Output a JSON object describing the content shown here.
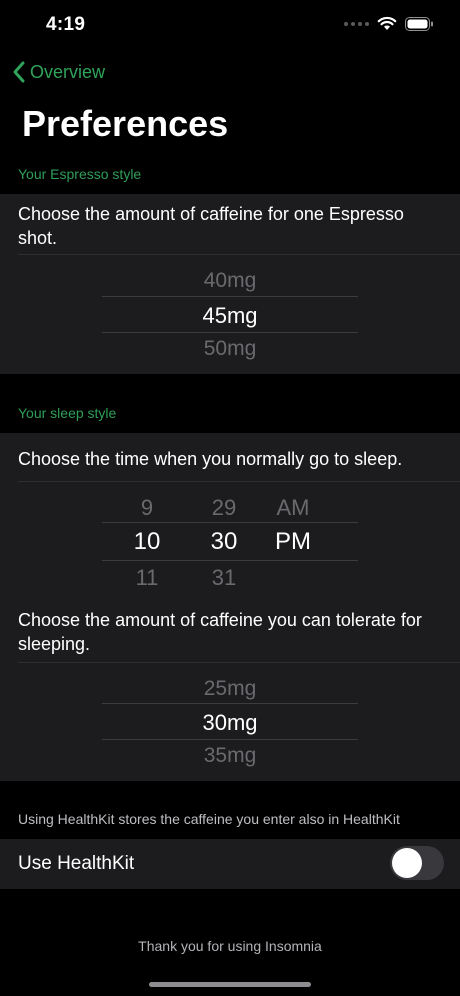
{
  "status": {
    "time": "4:19"
  },
  "nav": {
    "back_label": "Overview",
    "title": "Preferences"
  },
  "espresso": {
    "header": "Your Espresso style",
    "description": "Choose the amount of caffeine for one Espresso shot.",
    "picker": {
      "above": "40mg",
      "selected": "45mg",
      "below": "50mg"
    }
  },
  "sleep": {
    "header": "Your sleep style",
    "time_description": "Choose the time when you normally go to sleep.",
    "time_picker": {
      "hour": {
        "above": "9",
        "selected": "10",
        "below": "11"
      },
      "minute": {
        "above": "29",
        "selected": "30",
        "below": "31"
      },
      "period": {
        "above": "AM",
        "selected": "PM"
      }
    },
    "tolerance_description": "Choose the amount of caffeine you can tolerate for sleeping.",
    "tolerance_picker": {
      "above": "25mg",
      "selected": "30mg",
      "below": "35mg"
    }
  },
  "healthkit": {
    "note": "Using HealthKit stores the caffeine you enter also in HealthKit",
    "label": "Use HealthKit",
    "enabled": false
  },
  "footer": {
    "thanks": "Thank you for using Insomnia"
  },
  "colors": {
    "accent": "#30a35a",
    "card": "#1c1c1e",
    "background": "#000000"
  }
}
